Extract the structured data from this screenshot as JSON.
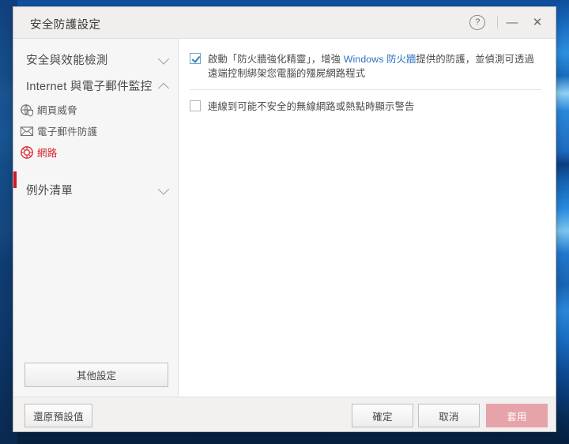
{
  "window": {
    "title": "安全防護設定",
    "titlebar_buttons": [
      {
        "name": "help",
        "glyph": "?"
      },
      {
        "name": "minimize",
        "glyph": "—"
      },
      {
        "name": "close",
        "glyph": "✕"
      }
    ]
  },
  "sidebar": {
    "groups": [
      {
        "label": "安全與效能檢測",
        "expanded": false,
        "chevron": "chevron-down"
      },
      {
        "label": "Internet 與電子郵件監控",
        "expanded": true,
        "chevron": "chevron-up"
      }
    ],
    "items": [
      {
        "label": "網頁威脅",
        "icon": "web-threat-icon",
        "selected": false
      },
      {
        "label": "電子郵件防護",
        "icon": "email-shield-icon",
        "selected": false
      },
      {
        "label": "網路",
        "icon": "network-icon",
        "selected": true
      }
    ],
    "exception_group": {
      "label": "例外清單",
      "expanded": false,
      "chevron": "chevron-down"
    },
    "other_settings_label": "其他設定",
    "selected_accent_color": "#d0191f"
  },
  "content": {
    "options": [
      {
        "checked": true,
        "text_before": "啟動「防火牆強化精靈」，增強 ",
        "highlight": "Windows 防火牆",
        "text_after": "提供的防護，並偵測可透過遠端控制綁架您電腦的殭屍網路程式",
        "highlight_color": "#2a6fc0"
      },
      {
        "checked": false,
        "text": "連線到可能不安全的無線網路或熱點時顯示警告"
      }
    ]
  },
  "footer": {
    "restore_label": "還原預設值",
    "ok_label": "確定",
    "cancel_label": "取消",
    "apply_label": "套用",
    "apply_color": "#e6a3aa"
  }
}
